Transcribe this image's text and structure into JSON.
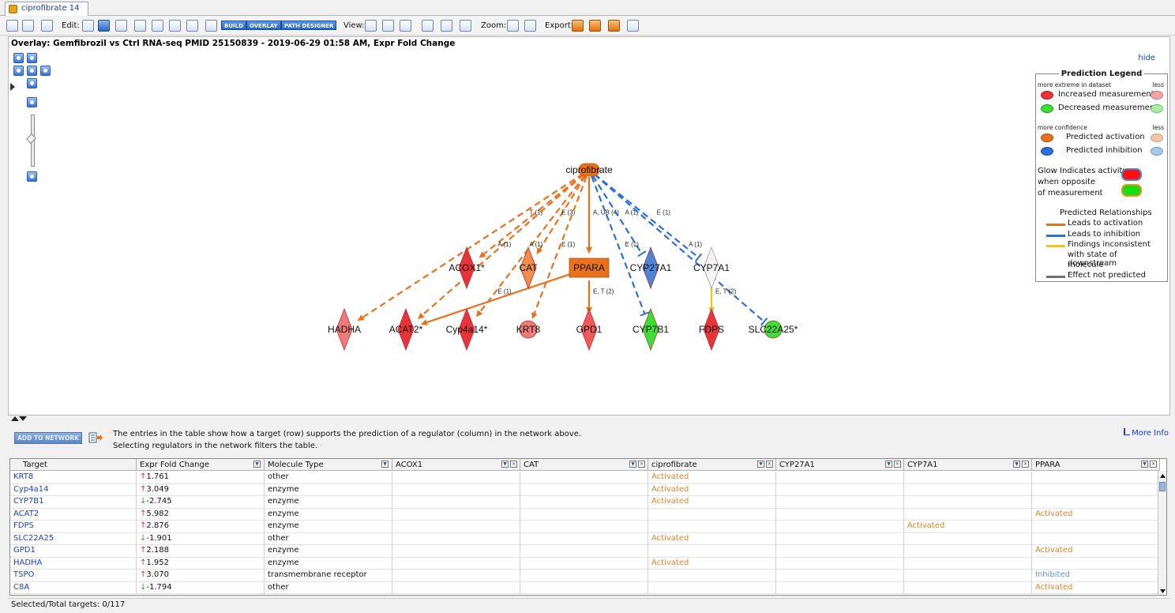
{
  "tab": {
    "label": "ciprofibrate 14"
  },
  "toolbar": {
    "edit_label": "Edit:",
    "build_label": "BUILD",
    "overlay_label": "OVERLAY",
    "path_designer_label": "PATH DESIGNER",
    "view_label": "View:",
    "zoom_label": "Zoom:",
    "export_label": "Export:"
  },
  "canvas": {
    "overlay_title": "Overlay: Gemfibrozil vs Ctrl RNA-seq PMID 25150839 - 2019-06-29 01:58 AM, Expr Fold Change",
    "hide_link": "hide"
  },
  "network": {
    "nodes": [
      {
        "id": "ciprofibrate",
        "label": "ciprofibrate",
        "shape": "round",
        "color": "#e9711c"
      },
      {
        "id": "ACOX1",
        "label": "ACOX1*",
        "shape": "diamond",
        "color": "#e8333a"
      },
      {
        "id": "CAT",
        "label": "CAT",
        "shape": "diamond",
        "color": "#f08c4c"
      },
      {
        "id": "PPARA",
        "label": "PPARA",
        "shape": "box",
        "color": "#e9711c"
      },
      {
        "id": "CYP27A1",
        "label": "CYP27A1",
        "shape": "diamond",
        "color": "#4a86d8"
      },
      {
        "id": "CYP7A1",
        "label": "CYP7A1",
        "shape": "diamond",
        "color": "#f4f4f4"
      },
      {
        "id": "HADHA",
        "label": "HADHA",
        "shape": "diamond",
        "color": "#f07a7a"
      },
      {
        "id": "ACAT2",
        "label": "ACAT2*",
        "shape": "diamond",
        "color": "#e8333a"
      },
      {
        "id": "Cyp4a14",
        "label": "Cyp4a14*",
        "shape": "diamond",
        "color": "#e8333a"
      },
      {
        "id": "KRT8",
        "label": "KRT8",
        "shape": "circle",
        "color": "#f07a7a"
      },
      {
        "id": "GPD1",
        "label": "GPD1",
        "shape": "diamond",
        "color": "#f05a5a"
      },
      {
        "id": "CYP7B1",
        "label": "CYP7B1",
        "shape": "diamond",
        "color": "#3ce034"
      },
      {
        "id": "FDPS",
        "label": "FDPS",
        "shape": "diamond",
        "color": "#e8333a"
      },
      {
        "id": "SLC22A25",
        "label": "SLC22A25*",
        "shape": "circle",
        "color": "#3ce034"
      }
    ],
    "edges": [
      {
        "from": "ciprofibrate",
        "to": "HADHA",
        "color": "#e9711c",
        "dashed": true,
        "label": ""
      },
      {
        "from": "ciprofibrate",
        "to": "ACOX1",
        "color": "#e9711c",
        "dashed": true,
        "label": "T (1)"
      },
      {
        "from": "ciprofibrate",
        "to": "ACAT2",
        "color": "#e9711c",
        "dashed": true,
        "label": "A (1)"
      },
      {
        "from": "ciprofibrate",
        "to": "CAT",
        "color": "#e9711c",
        "dashed": true,
        "label": "E (3)"
      },
      {
        "from": "ciprofibrate",
        "to": "Cyp4a14",
        "color": "#e9711c",
        "dashed": true,
        "label": "A (1)"
      },
      {
        "from": "ciprofibrate",
        "to": "KRT8",
        "color": "#e9711c",
        "dashed": true,
        "label": "E (1)"
      },
      {
        "from": "ciprofibrate",
        "to": "PPARA",
        "color": "#e9711c",
        "dashed": false,
        "label": "A, UB (4)"
      },
      {
        "from": "ciprofibrate",
        "to": "CYP27A1",
        "color": "#2a6fd8",
        "dashed": true,
        "label": "A (1)"
      },
      {
        "from": "ciprofibrate",
        "to": "CYP7B1",
        "color": "#2a6fd8",
        "dashed": true,
        "label": "E (1)"
      },
      {
        "from": "ciprofibrate",
        "to": "CYP7A1",
        "color": "#2a6fd8",
        "dashed": true,
        "label": "E (1)"
      },
      {
        "from": "ciprofibrate",
        "to": "SLC22A25",
        "color": "#2a6fd8",
        "dashed": true,
        "label": "A (1)"
      },
      {
        "from": "PPARA",
        "to": "ACAT2",
        "color": "#e9711c",
        "dashed": false,
        "label": "E (1)"
      },
      {
        "from": "PPARA",
        "to": "GPD1",
        "color": "#e9711c",
        "dashed": false,
        "label": "E, T (2)"
      },
      {
        "from": "CYP7A1",
        "to": "FDPS",
        "color": "#f0c419",
        "dashed": false,
        "label": "E, T (2)"
      }
    ]
  },
  "legend": {
    "title": "Prediction Legend",
    "extreme_label": "more extreme in dataset",
    "less_label": "less",
    "increased": "Increased measurement",
    "decreased": "Decreased measurement",
    "confidence_label": "more confidence",
    "less_label_2": "less",
    "activation": "Predicted activation",
    "inhibition": "Predicted inhibition",
    "glow_1": "Glow Indicates activity",
    "glow_2": "when opposite",
    "glow_3": "of measurement",
    "relationships_title": "Predicted Relationships",
    "rel_activation": "Leads to activation",
    "rel_inhibition": "Leads to inhibition",
    "rel_inconsistent_1": "Findings inconsistent",
    "rel_inconsistent_2": "with state of downstream",
    "rel_inconsistent_3": "molecule",
    "rel_not_predicted": "Effect not predicted",
    "colors": {
      "increased_strong": "#e8333a",
      "increased_light": "#f4a3a3",
      "decreased_strong": "#3ce034",
      "decreased_light": "#a9ecaa",
      "activation_strong": "#e9711c",
      "activation_light": "#f6c4a0",
      "inhibition_strong": "#2a6fd8",
      "inhibition_light": "#a8c8ef",
      "rel_activation": "#e9711c",
      "rel_inhibition": "#2a6fd8",
      "rel_inconsistent": "#f0c419",
      "rel_not_predicted": "#707070"
    }
  },
  "lower": {
    "add_button": "ADD TO NETWORK",
    "info_line_1": "The entries in the table show how a target (row) supports the prediction of a regulator (column) in the network above.",
    "info_line_2": "Selecting regulators in the network filters the table.",
    "more_info": "More Info"
  },
  "table": {
    "headers": [
      "Target",
      "Expr Fold Change",
      "Molecule Type",
      "ACOX1",
      "CAT",
      "ciprofibrate",
      "CYP27A1",
      "CYP7A1",
      "PPARA"
    ],
    "rows": [
      {
        "target": "KRT8",
        "dir": "up",
        "fold": "1.761",
        "type": "other",
        "cells": [
          "",
          "",
          "Activated",
          "",
          "",
          ""
        ]
      },
      {
        "target": "Cyp4a14",
        "dir": "up",
        "fold": "3.049",
        "type": "enzyme",
        "cells": [
          "",
          "",
          "Activated",
          "",
          "",
          ""
        ]
      },
      {
        "target": "CYP7B1",
        "dir": "down",
        "fold": "-2.745",
        "type": "enzyme",
        "cells": [
          "",
          "",
          "Activated",
          "",
          "",
          ""
        ]
      },
      {
        "target": "ACAT2",
        "dir": "up",
        "fold": "5.982",
        "type": "enzyme",
        "cells": [
          "",
          "",
          "",
          "",
          "",
          "Activated"
        ]
      },
      {
        "target": "FDPS",
        "dir": "up",
        "fold": "2.876",
        "type": "enzyme",
        "cells": [
          "",
          "",
          "",
          "",
          "Activated",
          ""
        ]
      },
      {
        "target": "SLC22A25",
        "dir": "down",
        "fold": "-1.901",
        "type": "other",
        "cells": [
          "",
          "",
          "Activated",
          "",
          "",
          ""
        ]
      },
      {
        "target": "GPD1",
        "dir": "up",
        "fold": "2.188",
        "type": "enzyme",
        "cells": [
          "",
          "",
          "",
          "",
          "",
          "Activated"
        ]
      },
      {
        "target": "HADHA",
        "dir": "up",
        "fold": "1.952",
        "type": "enzyme",
        "cells": [
          "",
          "",
          "Activated",
          "",
          "",
          ""
        ]
      },
      {
        "target": "TSPO",
        "dir": "up",
        "fold": "3.070",
        "type": "transmembrane receptor",
        "cells": [
          "",
          "",
          "",
          "",
          "",
          "Inhibited"
        ]
      },
      {
        "target": "C8A",
        "dir": "down",
        "fold": "-1.794",
        "type": "other",
        "cells": [
          "",
          "",
          "",
          "",
          "",
          "Activated"
        ]
      }
    ]
  },
  "status": {
    "text": "Selected/Total targets: 0/117"
  }
}
